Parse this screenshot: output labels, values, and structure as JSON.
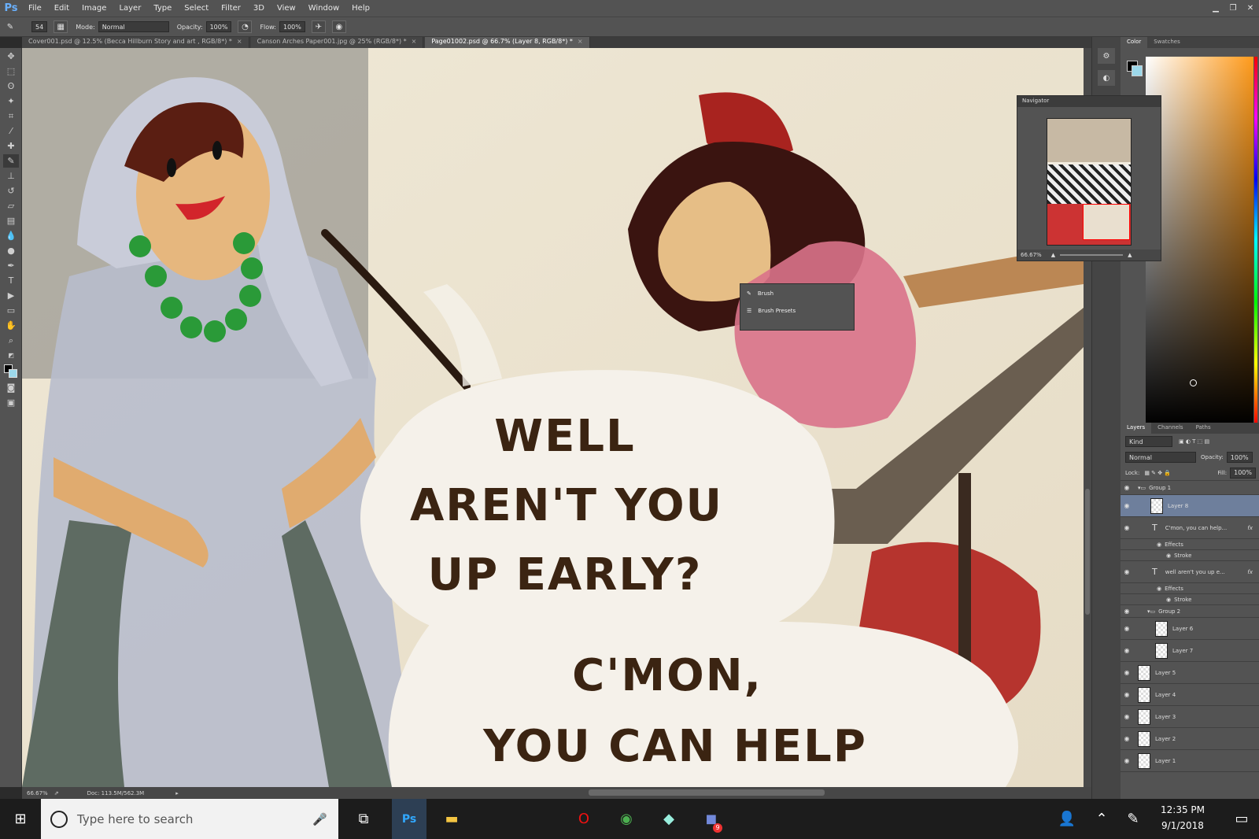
{
  "app": {
    "name": "Ps"
  },
  "menu": [
    "File",
    "Edit",
    "Image",
    "Layer",
    "Type",
    "Select",
    "Filter",
    "3D",
    "View",
    "Window",
    "Help"
  ],
  "options": {
    "brush_size": "54",
    "mode_label": "Mode:",
    "mode_value": "Normal",
    "opacity_label": "Opacity:",
    "opacity_value": "100%",
    "flow_label": "Flow:",
    "flow_value": "100%"
  },
  "tabs": [
    {
      "label": "Cover001.psd @ 12.5% (Becca Hillburn Story and art , RGB/8*) *"
    },
    {
      "label": "Canson Arches Paper001.jpg @ 25% (RGB/8*) *"
    },
    {
      "label": "Page01002.psd @ 66.7% (Layer 8, RGB/8*) *"
    }
  ],
  "canvas": {
    "bubble1": [
      "WELL",
      "AREN'T YOU",
      "UP EARLY?"
    ],
    "bubble2": [
      "C'MON,",
      "YOU CAN HELP"
    ]
  },
  "status": {
    "zoom": "66.67%",
    "doc": "Doc: 113.5M/562.3M"
  },
  "navigator": {
    "title": "Navigator",
    "zoom": "66.67%"
  },
  "brush_popup": {
    "items": [
      "Brush",
      "Brush Presets"
    ]
  },
  "color_panel": {
    "tabs": [
      "Color",
      "Swatches"
    ]
  },
  "layers_panel": {
    "tabs": [
      "Layers",
      "Channels",
      "Paths"
    ],
    "kind": "Kind",
    "blend": "Normal",
    "opacity_label": "Opacity:",
    "opacity_value": "100%",
    "lock_label": "Lock:",
    "fill_label": "Fill:",
    "fill_value": "100%",
    "rows": [
      {
        "name": "Group 1"
      },
      {
        "name": "Layer 8"
      },
      {
        "name": "C'mon, you can help..."
      },
      {
        "name": "Effects"
      },
      {
        "name": "Stroke"
      },
      {
        "name": "well aren't you up e..."
      },
      {
        "name": "Effects"
      },
      {
        "name": "Stroke"
      },
      {
        "name": "Group 2"
      },
      {
        "name": "Layer 6"
      },
      {
        "name": "Layer 7"
      },
      {
        "name": "Layer 5"
      },
      {
        "name": "Layer 4"
      },
      {
        "name": "Layer 3"
      },
      {
        "name": "Layer 2"
      },
      {
        "name": "Layer 1"
      }
    ]
  },
  "taskbar": {
    "search_placeholder": "Type here to search",
    "time": "12:35 PM",
    "date": "9/1/2018",
    "badge": "9"
  }
}
